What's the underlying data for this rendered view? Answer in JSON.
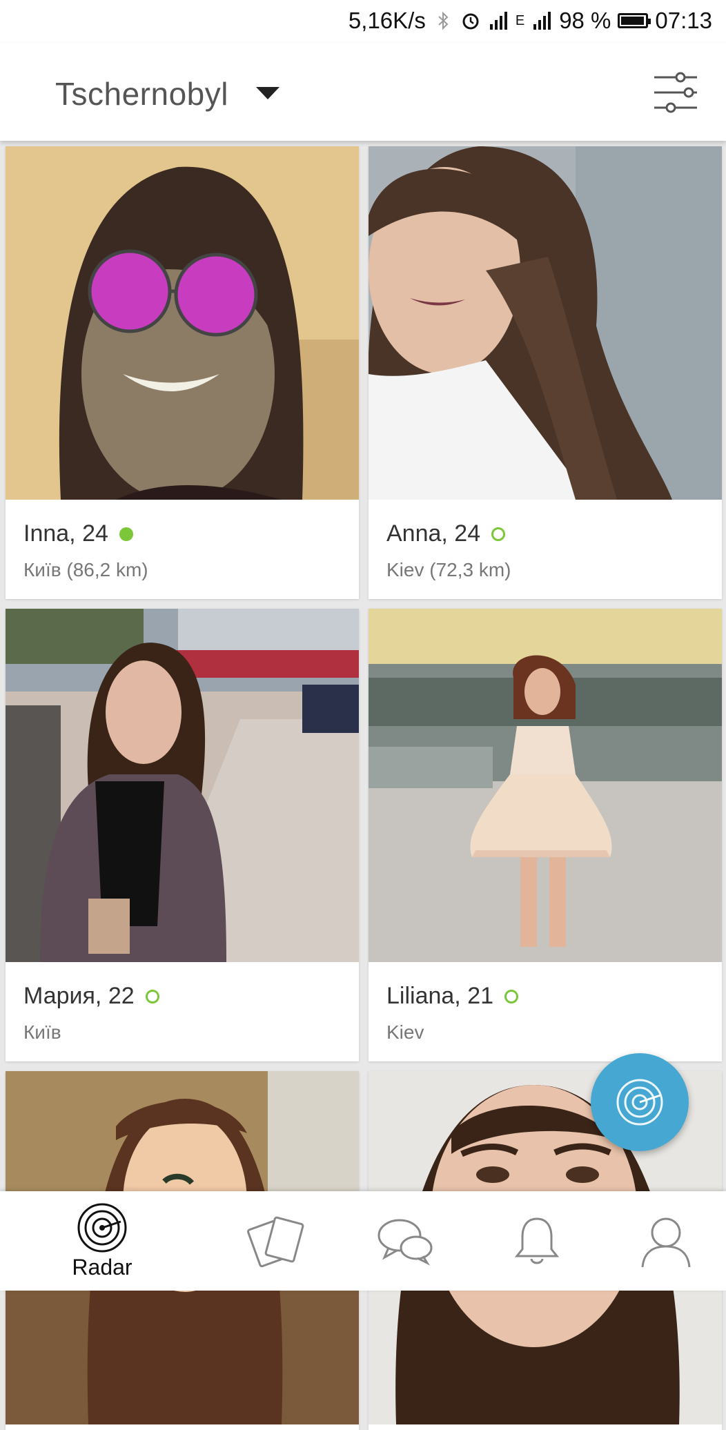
{
  "status_bar": {
    "network_speed": "5,16K/s",
    "network_type": "E",
    "battery": "98 %",
    "battery_level": 0.98,
    "time": "07:13"
  },
  "header": {
    "location": "Tschernobyl",
    "dropdown_icon": "caret-down-icon",
    "filter_icon": "sliders-icon"
  },
  "colors": {
    "accent": "#46a8d2",
    "online": "#7cc63a"
  },
  "profiles": [
    {
      "name": "Inna, 24",
      "city": "Київ (86,2 km)",
      "online": true
    },
    {
      "name": "Anna, 24",
      "city": "Kiev (72,3 km)",
      "online": false
    },
    {
      "name": "Мария, 22",
      "city": "Київ",
      "online": false
    },
    {
      "name": "Liliana, 21",
      "city": "Kiev",
      "online": false
    },
    {
      "name": "",
      "city": "",
      "online": false
    },
    {
      "name": "",
      "city": "",
      "online": false
    }
  ],
  "fab": {
    "icon": "radar-icon"
  },
  "bottom_nav": {
    "items": [
      {
        "label": "Radar",
        "icon": "radar-icon",
        "active": true
      },
      {
        "label": "",
        "icon": "cards-icon",
        "active": false
      },
      {
        "label": "",
        "icon": "chat-icon",
        "active": false
      },
      {
        "label": "",
        "icon": "bell-icon",
        "active": false
      },
      {
        "label": "",
        "icon": "profile-icon",
        "active": false
      }
    ]
  }
}
